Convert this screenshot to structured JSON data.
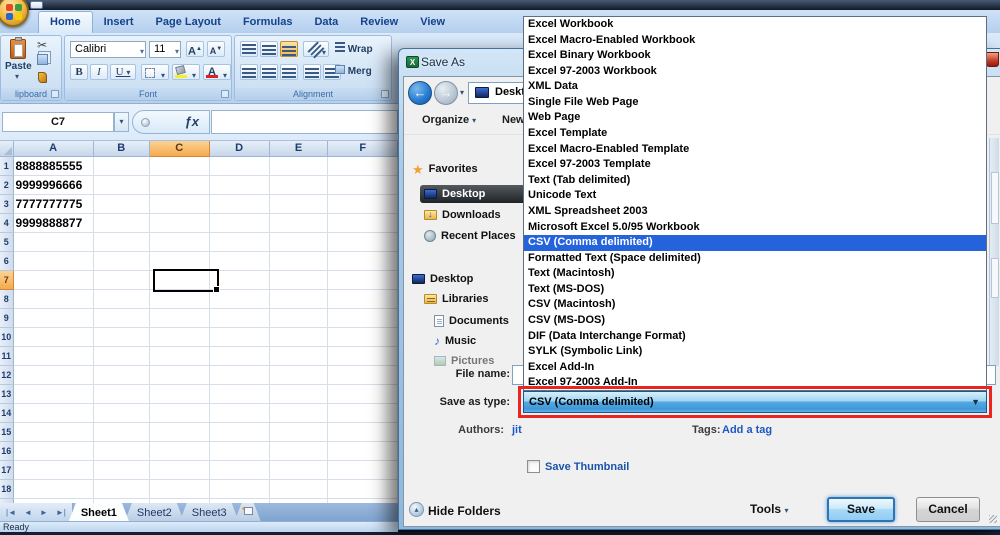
{
  "excel": {
    "ribbon_tabs": [
      {
        "label": "Home",
        "active": true
      },
      {
        "label": "Insert",
        "active": false
      },
      {
        "label": "Page Layout",
        "active": false
      },
      {
        "label": "Formulas",
        "active": false
      },
      {
        "label": "Data",
        "active": false
      },
      {
        "label": "Review",
        "active": false
      },
      {
        "label": "View",
        "active": false
      }
    ],
    "clipboard_group": {
      "group_label": "lipboard",
      "paste_label": "Paste"
    },
    "font_group": {
      "group_label": "Font",
      "font_name": "Calibri",
      "font_size": "11",
      "bold_label": "B",
      "italic_label": "I",
      "underline_label": "U",
      "grow_font_label": "A",
      "shrink_font_label": "A",
      "font_color_label": "A"
    },
    "alignment_group": {
      "group_label": "Alignment",
      "wrap_label": "Wrap",
      "merge_label": "Merg"
    },
    "formula_bar": {
      "name_box": "C7",
      "fx_label": "ƒx"
    },
    "grid": {
      "columns": [
        "A",
        "B",
        "C",
        "D",
        "E",
        "F"
      ],
      "selected_column": "C",
      "selected_row": 7,
      "row_count": 19,
      "cells": {
        "A1": "8888885555",
        "A2": "9999996666",
        "A3": "7777777775",
        "A4": "9999888877"
      }
    },
    "sheet_bar": {
      "nav": [
        "|◄",
        "◄",
        "►",
        "►|"
      ],
      "sheets": [
        {
          "label": "Sheet1",
          "active": true
        },
        {
          "label": "Sheet2",
          "active": false
        },
        {
          "label": "Sheet3",
          "active": false
        }
      ]
    },
    "status_bar": {
      "text": "Ready"
    }
  },
  "save_dialog": {
    "title": "Save As",
    "address": "Desktop",
    "organize_label": "Organize",
    "new_folder_label": "New folder",
    "sidebar": [
      {
        "label": "Favorites",
        "icon": "star-icon",
        "level": 0,
        "selected": false,
        "clipped": false
      },
      {
        "label": "Desktop",
        "icon": "desktop-icon",
        "level": 1,
        "selected": true,
        "clipped": false
      },
      {
        "label": "Downloads",
        "icon": "downloads-icon",
        "level": 1,
        "selected": false,
        "clipped": false
      },
      {
        "label": "Recent Places",
        "icon": "recent-places-icon",
        "level": 1,
        "selected": false,
        "clipped": false
      },
      {
        "label": "Desktop",
        "icon": "desktop-icon",
        "level": 0,
        "selected": false,
        "clipped": false
      },
      {
        "label": "Libraries",
        "icon": "libraries-icon",
        "level": 1,
        "selected": false,
        "clipped": false
      },
      {
        "label": "Documents",
        "icon": "documents-icon",
        "level": 2,
        "selected": false,
        "clipped": false
      },
      {
        "label": "Music",
        "icon": "music-icon",
        "level": 2,
        "selected": false,
        "clipped": false
      },
      {
        "label": "Pictures",
        "icon": "pictures-icon",
        "level": 2,
        "selected": false,
        "clipped": true
      }
    ],
    "file_name_label": "File name:",
    "save_as_type_label": "Save as type:",
    "save_as_type_value": "CSV (Comma delimited)",
    "authors_label": "Authors:",
    "authors_value": "jit",
    "tags_label": "Tags:",
    "tags_value": "Add a tag",
    "save_thumbnail_label": "Save Thumbnail",
    "hide_folders_label": "Hide Folders",
    "tools_label": "Tools",
    "save_label": "Save",
    "cancel_label": "Cancel"
  },
  "type_dropdown": {
    "selected": "CSV (Comma delimited)",
    "items": [
      "Excel Workbook",
      "Excel Macro-Enabled Workbook",
      "Excel Binary Workbook",
      "Excel 97-2003 Workbook",
      "XML Data",
      "Single File Web Page",
      "Web Page",
      "Excel Template",
      "Excel Macro-Enabled Template",
      "Excel 97-2003 Template",
      "Text (Tab delimited)",
      "Unicode Text",
      "XML Spreadsheet 2003",
      "Microsoft Excel 5.0/95 Workbook",
      "CSV (Comma delimited)",
      "Formatted Text (Space delimited)",
      "Text (Macintosh)",
      "Text (MS-DOS)",
      "CSV (Macintosh)",
      "CSV (MS-DOS)",
      "DIF (Data Interchange Format)",
      "SYLK (Symbolic Link)",
      "Excel Add-In",
      "Excel 97-2003 Add-In"
    ]
  },
  "icons": {
    "caret_down": "▾",
    "combo_arrow": "▼",
    "back_arrow": "←",
    "forward_arrow": "→",
    "up_arrow": "▴",
    "scissors": "✂",
    "music_note": "♪"
  },
  "colors": {
    "selection_blue": "#2563dd",
    "annotation_red": "#e8261f",
    "selected_header_orange": "#f6a94d",
    "link_blue": "#1d58c4",
    "combo_blue": "#3f97d8"
  }
}
